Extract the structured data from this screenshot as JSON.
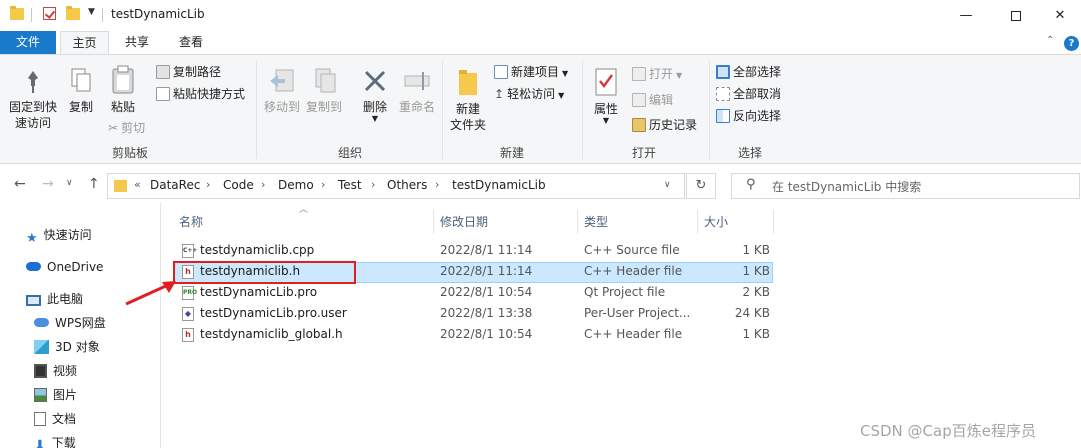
{
  "window": {
    "title": "testDynamicLib"
  },
  "tabs": {
    "file": "文件",
    "home": "主页",
    "share": "共享",
    "view": "查看"
  },
  "ribbon": {
    "clipboard": {
      "group": "剪贴板",
      "pin": "固定到快\n速访问",
      "copy": "复制",
      "paste": "粘贴",
      "copy_path": "复制路径",
      "paste_shortcut": "粘贴快捷方式",
      "cut": "剪切"
    },
    "organize": {
      "group": "组织",
      "move_to": "移动到",
      "copy_to": "复制到",
      "delete": "删除",
      "rename": "重命名"
    },
    "new": {
      "group": "新建",
      "new_folder": "新建\n文件夹",
      "new_item": "新建项目",
      "easy_access": "轻松访问"
    },
    "open": {
      "group": "打开",
      "properties": "属性",
      "open": "打开",
      "edit": "编辑",
      "history": "历史记录"
    },
    "select": {
      "group": "选择",
      "select_all": "全部选择",
      "select_none": "全部取消",
      "invert": "反向选择"
    }
  },
  "address": {
    "overflow": "«",
    "crumbs": [
      "DataRec",
      "Code",
      "Demo",
      "Test",
      "Others",
      "testDynamicLib"
    ]
  },
  "search": {
    "placeholder": "在 testDynamicLib 中搜索"
  },
  "nav": {
    "items": [
      "快速访问",
      "OneDrive",
      "此电脑",
      "WPS网盘",
      "3D 对象",
      "视频",
      "图片",
      "文档",
      "下载"
    ]
  },
  "columns": {
    "name": "名称",
    "modified": "修改日期",
    "type": "类型",
    "size": "大小"
  },
  "files": [
    {
      "name": "testdynamiclib.cpp",
      "modified": "2022/8/1 11:14",
      "type": "C++ Source file",
      "size": "1 KB",
      "icon": "cpp-file-icon"
    },
    {
      "name": "testdynamiclib.h",
      "modified": "2022/8/1 11:14",
      "type": "C++ Header file",
      "size": "1 KB",
      "icon": "header-file-icon"
    },
    {
      "name": "testDynamicLib.pro",
      "modified": "2022/8/1 10:54",
      "type": "Qt Project file",
      "size": "2 KB",
      "icon": "pro-file-icon"
    },
    {
      "name": "testDynamicLib.pro.user",
      "modified": "2022/8/1 13:38",
      "type": "Per-User Project...",
      "size": "24 KB",
      "icon": "user-file-icon"
    },
    {
      "name": "testdynamiclib_global.h",
      "modified": "2022/8/1 10:54",
      "type": "C++ Header file",
      "size": "1 KB",
      "icon": "header-file-icon"
    }
  ],
  "watermark": "CSDN @Cap百炼e程序员"
}
